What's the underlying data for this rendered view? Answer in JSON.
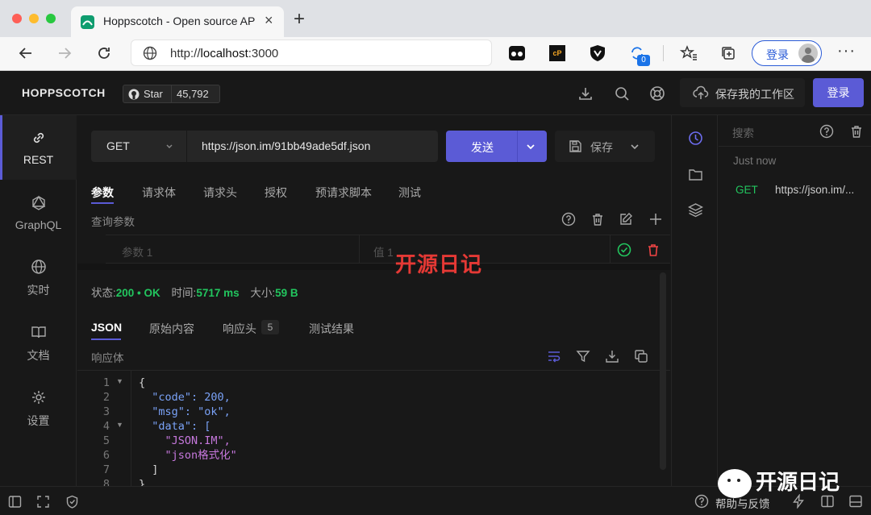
{
  "browser": {
    "tab_title": "Hoppscotch - Open source AP",
    "url_prefix": "http://",
    "url_host": "localhost",
    "url_port": ":3000",
    "login_label": "登录",
    "ext_badge": "0"
  },
  "header": {
    "brand": "HOPPSCOTCH",
    "star_label": "Star",
    "star_count": "45,792",
    "save_workspace": "保存我的工作区",
    "login": "登录"
  },
  "sidebar": {
    "items": [
      {
        "label": "REST",
        "icon": "link-icon"
      },
      {
        "label": "GraphQL",
        "icon": "graphql-icon"
      },
      {
        "label": "实时",
        "icon": "globe-icon"
      },
      {
        "label": "文档",
        "icon": "book-icon"
      },
      {
        "label": "设置",
        "icon": "gear-icon"
      }
    ]
  },
  "request": {
    "method": "GET",
    "url": "https://json.im/91bb49ade5df.json",
    "send": "发送",
    "save": "保存",
    "tabs": [
      "参数",
      "请求体",
      "请求头",
      "授权",
      "预请求脚本",
      "测试"
    ],
    "query_title": "查询参数",
    "param_placeholder": "参数 1",
    "value_placeholder": "值 1"
  },
  "watermark": "开源日记",
  "response": {
    "status_label": "状态:",
    "status_value": "200 • OK",
    "time_label": "时间:",
    "time_value": "5717 ms",
    "size_label": "大小:",
    "size_value": "59 B",
    "tabs": [
      "JSON",
      "原始内容",
      "响应头",
      "测试结果"
    ],
    "headers_count": "5",
    "body_title": "响应体",
    "code": {
      "line_numbers": [
        "1",
        "2",
        "3",
        "4",
        "5",
        "6",
        "7",
        "8"
      ],
      "lines": [
        "{",
        "  \"code\": 200,",
        "  \"msg\": \"ok\",",
        "  \"data\": [",
        "    \"JSON.IM\",",
        "    \"json格式化\"",
        "  ]",
        "}"
      ]
    }
  },
  "history": {
    "search_placeholder": "搜索",
    "time_group": "Just now",
    "entry_method": "GET",
    "entry_url": "https://json.im/..."
  },
  "footer": {
    "help": "帮助与反馈",
    "wechat_watermark": "开源日记"
  },
  "colors": {
    "accent": "#5b5bd6",
    "success": "#22c55e",
    "danger": "#ef4444",
    "watermark_red": "#e53935"
  }
}
